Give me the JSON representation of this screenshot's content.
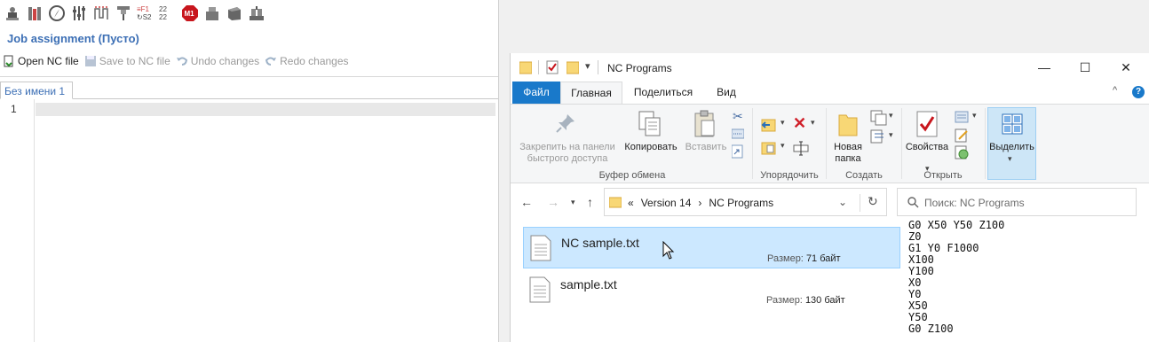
{
  "cam": {
    "toolbar_icons": [
      "machine-icon",
      "stock-icon",
      "compass-icon",
      "tuners-icon",
      "path-icon",
      "tool-icon",
      "feeds-speeds-icon",
      "grid-icon",
      "m1-stop-icon",
      "part-icon",
      "block-icon",
      "vise-icon"
    ],
    "job_title": "Job assignment (Пусто)",
    "actions": {
      "open": "Open NC file",
      "save": "Save to NC file",
      "undo": "Undo changes",
      "redo": "Redo changes"
    },
    "tab_label": "Без имени 1",
    "line_number": "1"
  },
  "explorer": {
    "title": "NC Programs",
    "window_controls": {
      "minimize": "—",
      "maximize": "☐",
      "close": "✕"
    },
    "ribbon_tabs": {
      "file": "Файл",
      "home": "Главная",
      "share": "Поделиться",
      "view": "Вид"
    },
    "ribbon": {
      "pin_label": "Закрепить на панели быстрого доступа",
      "copy_label": "Копировать",
      "paste_label": "Вставить",
      "clipboard_group": "Буфер обмена",
      "organize_group": "Упорядочить",
      "new_folder_label": "Новая папка",
      "create_group": "Создать",
      "properties_label": "Свойства",
      "open_group": "Открыть",
      "select_label": "Выделить"
    },
    "breadcrumb": {
      "prefix": "«",
      "level1": "Version 14",
      "sep": "›",
      "level2": "NC Programs"
    },
    "search_placeholder": "Поиск: NC Programs",
    "files": [
      {
        "name": "NC sample.txt",
        "size_label": "Размер:",
        "size": "71 байт",
        "selected": true
      },
      {
        "name": "sample.txt",
        "size_label": "Размер:",
        "size": "130 байт",
        "selected": false
      }
    ],
    "preview": "G0 X50 Y50 Z100\nZ0\nG1 Y0 F1000\nX100\nY100\nX0\nY0\nX50\nY50\nG0 Z100"
  },
  "colors": {
    "accent_blue": "#1979ca",
    "cam_title": "#3c6fb5",
    "selection": "#cce8ff"
  }
}
